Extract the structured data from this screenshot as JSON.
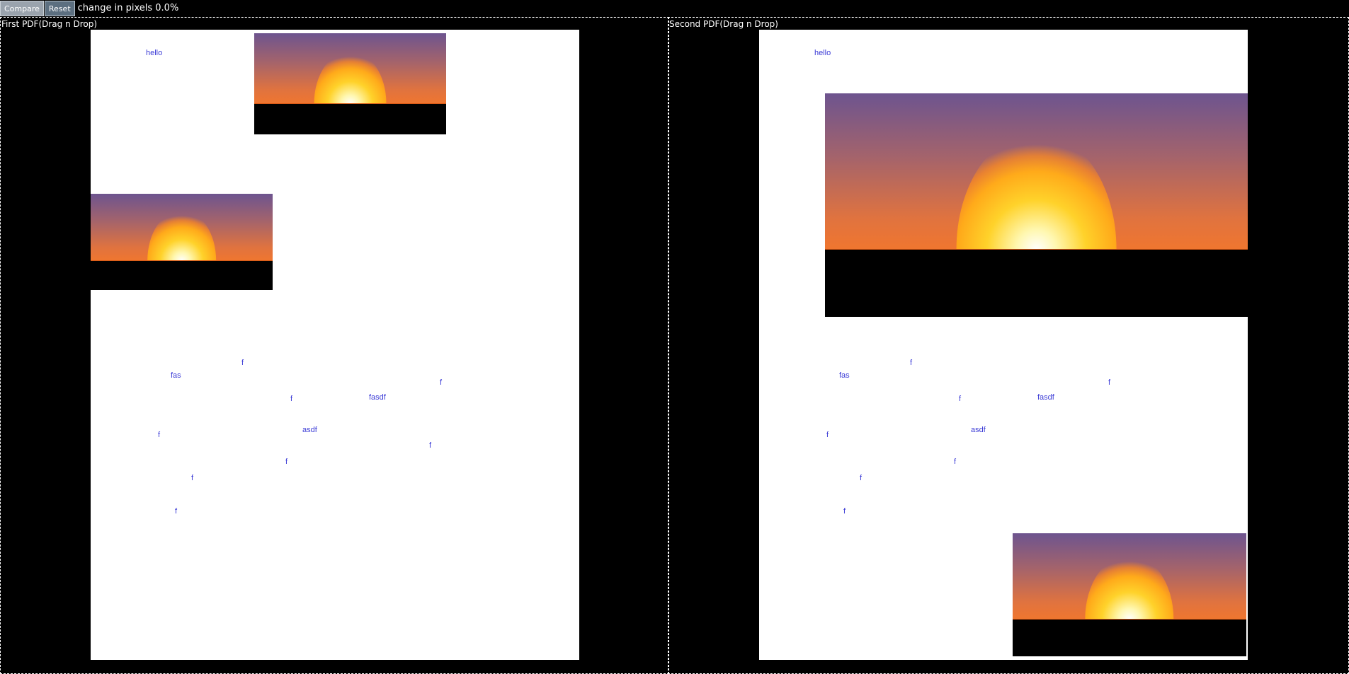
{
  "toolbar": {
    "compare_label": "Compare",
    "reset_label": "Reset",
    "status_text": "change in pixels 0.0%"
  },
  "left_pane": {
    "label": "First PDF(Drag n Drop)",
    "texts": [
      "hello",
      "f",
      "fas",
      "f",
      "f",
      "fasdf",
      "asdf",
      "f",
      "f",
      "f",
      "f",
      "f"
    ]
  },
  "right_pane": {
    "label": "Second PDF(Drag n Drop)",
    "texts": [
      "hello",
      "f",
      "fas",
      "f",
      "f",
      "fasdf",
      "asdf",
      "f",
      "f",
      "f",
      "f"
    ]
  },
  "colors": {
    "background": "#000000",
    "page": "#ffffff",
    "text": "#3b3bd6",
    "compare_button": "#9aa3ad",
    "reset_button": "#5c6f80"
  }
}
